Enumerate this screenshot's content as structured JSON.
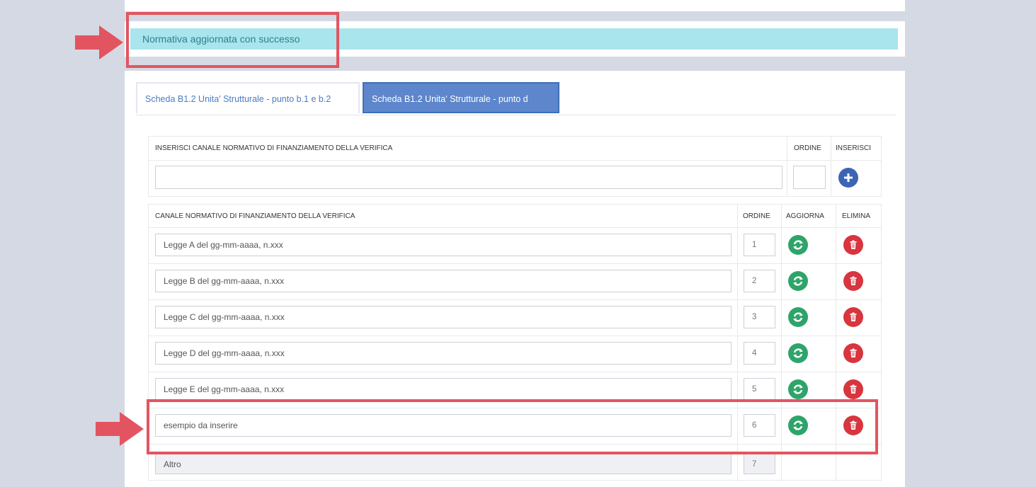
{
  "alert": {
    "message": "Normativa aggiornata con successo"
  },
  "tabs": [
    {
      "label": "Scheda B1.2 Unita' Strutturale - punto b.1 e b.2",
      "active": false
    },
    {
      "label": "Scheda B1.2 Unita' Strutturale - punto d",
      "active": true
    }
  ],
  "insert_form": {
    "header_channel": "INSERISCI CANALE NORMATIVO DI FINANZIAMENTO DELLA VERIFICA",
    "header_order": "ORDINE",
    "header_insert": "INSERISCI",
    "channel_value": "",
    "order_value": "",
    "insert_icon": "plus-icon"
  },
  "list": {
    "header_channel": "CANALE NORMATIVO DI FINANZIAMENTO DELLA VERIFICA",
    "header_order": "ORDINE",
    "header_update": "AGGIORNA",
    "header_delete": "ELIMINA",
    "rows": [
      {
        "channel": "Legge A del gg-mm-aaaa, n.xxx",
        "order": "1",
        "editable": true
      },
      {
        "channel": "Legge B del gg-mm-aaaa, n.xxx",
        "order": "2",
        "editable": true
      },
      {
        "channel": "Legge C del gg-mm-aaaa, n.xxx",
        "order": "3",
        "editable": true
      },
      {
        "channel": "Legge D del gg-mm-aaaa, n.xxx",
        "order": "4",
        "editable": true
      },
      {
        "channel": "Legge E del gg-mm-aaaa, n.xxx",
        "order": "5",
        "editable": true
      },
      {
        "channel": "esempio da inserire",
        "order": "6",
        "editable": true
      },
      {
        "channel": "Altro",
        "order": "7",
        "editable": false
      }
    ],
    "update_icon": "refresh-icon",
    "delete_icon": "trash-icon"
  },
  "colors": {
    "alert_bg": "#a8e5ec",
    "alert_text": "#31808d",
    "active_tab": "#5d86cc",
    "update_green": "#2fa46a",
    "delete_red": "#d8353f",
    "insert_blue": "#3b64b4",
    "annotation_red": "#e25560"
  }
}
